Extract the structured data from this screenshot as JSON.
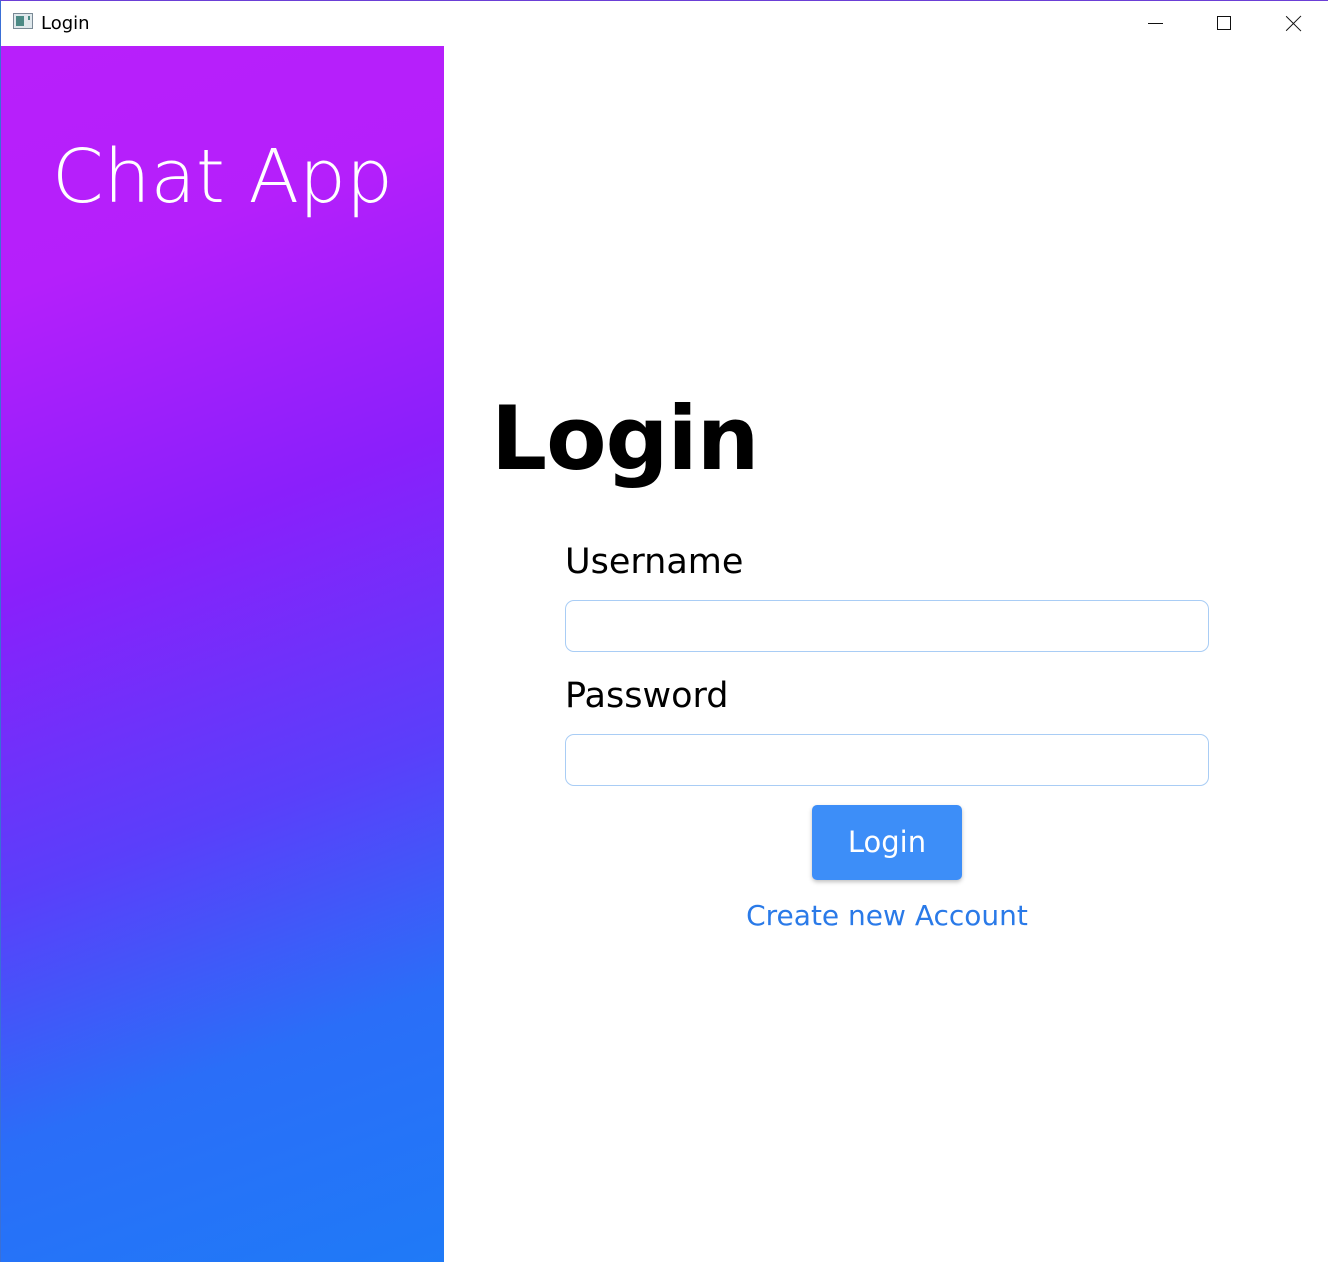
{
  "window": {
    "title": "Login",
    "controls": {
      "minimize_icon": "minimize-icon",
      "maximize_icon": "maximize-icon",
      "close_icon": "close-icon"
    }
  },
  "sidebar": {
    "brand": "Chat App",
    "gradient_top": "#b81ffb",
    "gradient_bottom": "#1f7af7"
  },
  "form": {
    "heading": "Login",
    "username_label": "Username",
    "username_value": "",
    "password_label": "Password",
    "password_value": "",
    "login_button": "Login",
    "create_account_link": "Create new Account"
  },
  "colors": {
    "button": "#3d8ef8",
    "link": "#2a7ae8",
    "input_border": "#a9cdf5"
  }
}
